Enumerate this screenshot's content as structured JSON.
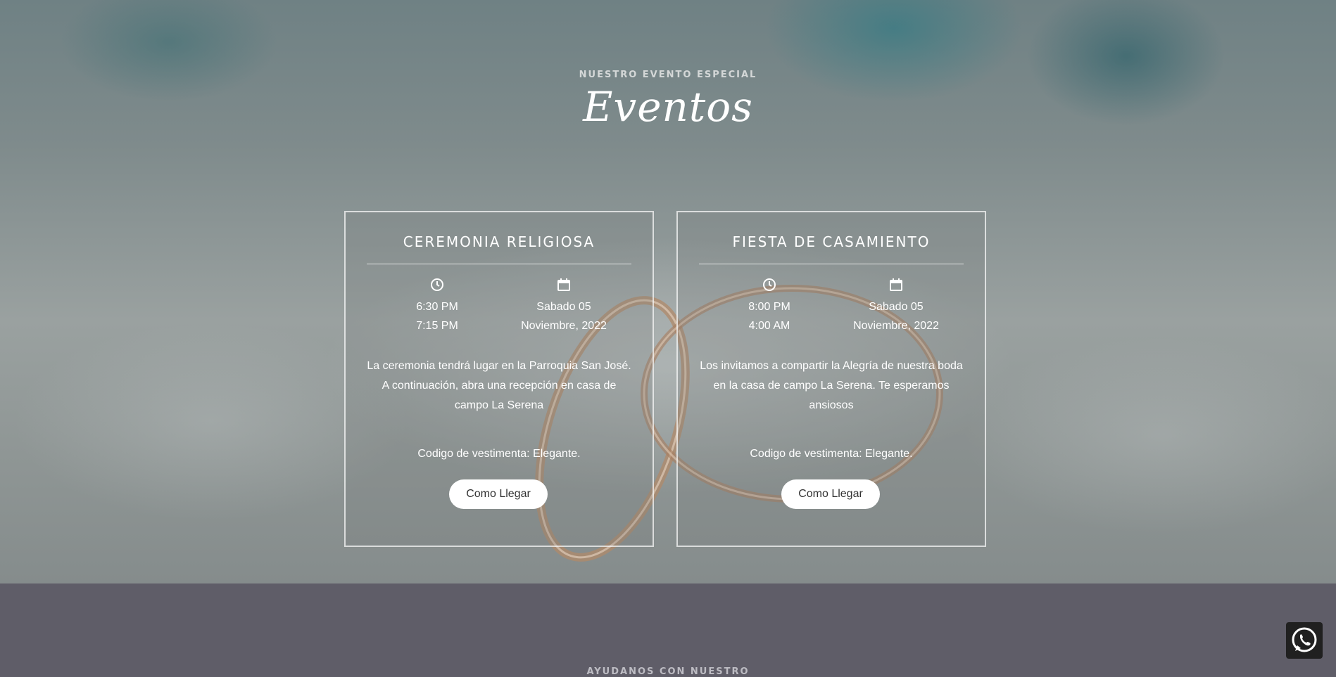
{
  "events": {
    "eyebrow": "NUESTRO EVENTO ESPECIAL",
    "title": "Eventos",
    "cards": [
      {
        "title": "CEREMONIA RELIGIOSA",
        "time_start": "6:30 PM",
        "time_end": "7:15 PM",
        "date_day": "Sabado 05",
        "date_month": "Noviembre, 2022",
        "description": "La ceremonia tendrá lugar en la Parroquia San José. A continuación, abra una recepción en casa de campo La Serena",
        "dress_code": "Codigo de vestimenta: Elegante.",
        "button_label": "Como Llegar"
      },
      {
        "title": "FIESTA DE CASAMIENTO",
        "time_start": "8:00 PM",
        "time_end": "4:00 AM",
        "date_day": "Sabado 05",
        "date_month": "Noviembre, 2022",
        "description": "Los invitamos a compartir la Alegría de nuestra boda en la casa de campo La Serena. Te esperamos ansiosos",
        "dress_code": "Codigo de vestimenta: Elegante.",
        "button_label": "Como Llegar"
      }
    ]
  },
  "next_section": {
    "eyebrow": "AYUDANOS CON NUESTRO"
  },
  "icons": {
    "time": "clock-icon",
    "date": "calendar-icon",
    "chat": "whatsapp-icon"
  },
  "colors": {
    "card_border": "#ffffff",
    "button_bg": "#ffffff",
    "lower_section_bg": "#5f5d68",
    "whatsapp_bg": "#202020"
  }
}
